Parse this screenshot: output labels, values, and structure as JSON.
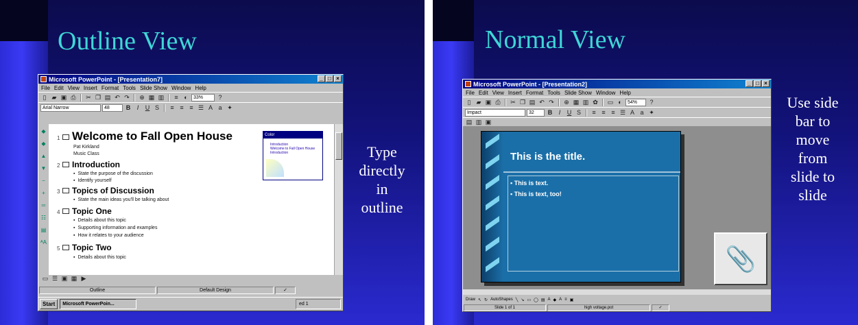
{
  "left_slide": {
    "title": "Outline View",
    "caption": [
      "Type",
      "directly",
      "in",
      "outline"
    ],
    "window": {
      "title": "Microsoft PowerPoint - [Presentation7]",
      "menu": [
        "File",
        "Edit",
        "View",
        "Insert",
        "Format",
        "Tools",
        "Slide Show",
        "Window",
        "Help"
      ],
      "font_name": "Arial Narrow",
      "font_size": "48",
      "zoom": "33%",
      "color_window_title": "Color",
      "color_window_text": [
        "Introduction",
        "Welcome to Fall Open House",
        "Introduction"
      ],
      "outline": [
        {
          "num": "1",
          "heading": "Welcome to Fall Open House",
          "subtext": [
            "Pat Kirkland",
            "Music Class"
          ],
          "bullets": []
        },
        {
          "num": "2",
          "heading": "Introduction",
          "subtext": [],
          "bullets": [
            "State the purpose of the discussion",
            "Identify yourself"
          ]
        },
        {
          "num": "3",
          "heading": "Topics of Discussion",
          "subtext": [],
          "bullets": [
            "State the main ideas you'll be talking about"
          ]
        },
        {
          "num": "4",
          "heading": "Topic One",
          "subtext": [],
          "bullets": [
            "Details about this topic",
            "Supporting information and examples",
            "How it relates to your audience"
          ]
        },
        {
          "num": "5",
          "heading": "Topic Two",
          "subtext": [],
          "bullets": [
            "Details about this topic"
          ]
        }
      ],
      "status": {
        "view": "Outline",
        "design": "Default Design"
      },
      "taskbar": {
        "start": "Start",
        "task": "Microsoft PowerPoin...",
        "clock": "ed 1"
      }
    }
  },
  "right_slide": {
    "title": "Normal View",
    "caption": [
      "Use side",
      "bar to",
      "move",
      "from",
      "slide to",
      "slide"
    ],
    "window": {
      "title": "Microsoft PowerPoint - [Presentation2]",
      "menu": [
        "File",
        "Edit",
        "View",
        "Insert",
        "Format",
        "Tools",
        "Slide Show",
        "Window",
        "Help"
      ],
      "font_name": "Impact",
      "font_size": "32",
      "zoom": "54%",
      "slide_title": "This is the title.",
      "slide_bullets": [
        "This is text.",
        "This is text, too!"
      ],
      "draw_toolbar": [
        "Draw",
        "AutoShapes"
      ],
      "status": {
        "slide": "Slide 1 of 1",
        "design": "high voltage.pot"
      }
    }
  }
}
